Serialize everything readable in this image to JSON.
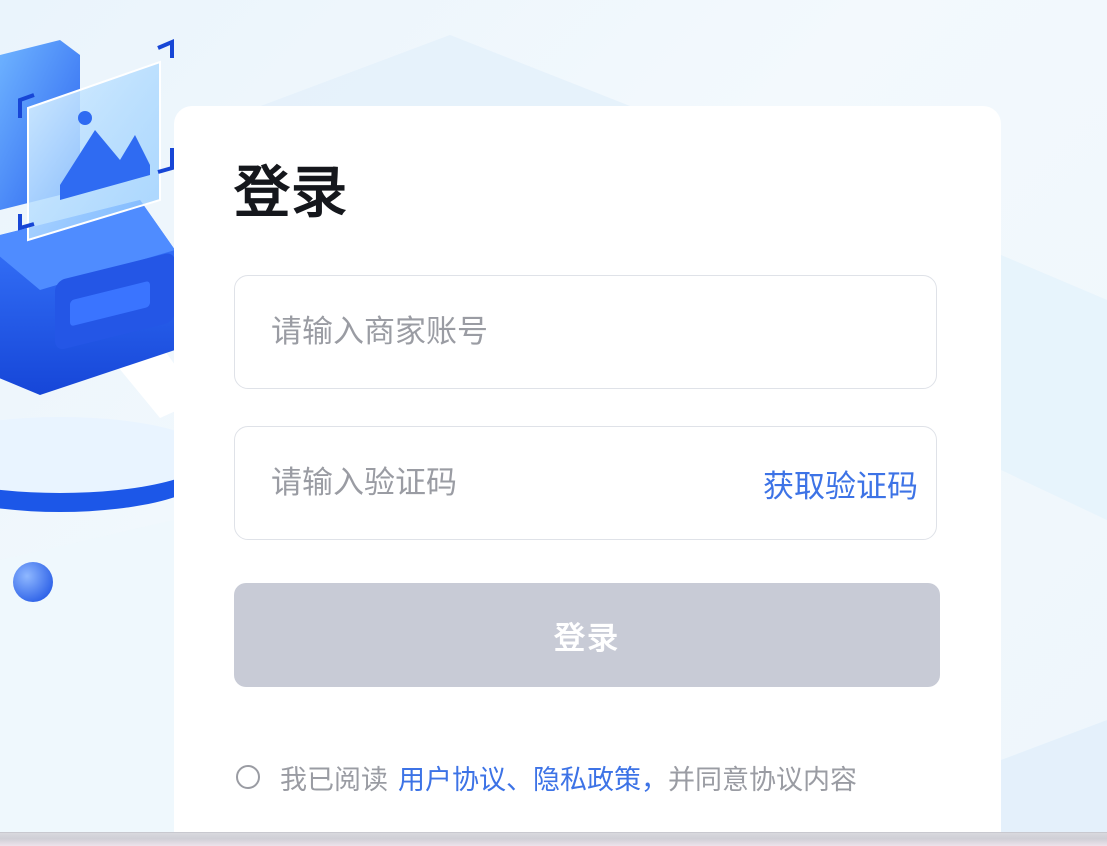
{
  "login": {
    "title": "登录",
    "account_placeholder": "请输入商家账号",
    "code_placeholder": "请输入验证码",
    "get_code_label": "获取验证码",
    "submit_label": "登录"
  },
  "agreement": {
    "prefix": "我已阅读",
    "user_agreement": "用户协议",
    "separator": "、",
    "privacy_policy": "隐私政策",
    "comma": "，",
    "suffix": "并同意协议内容",
    "checked": false
  },
  "icons": {
    "illustration": "printer-image-illustration",
    "radio": "radio-unchecked-icon"
  },
  "colors": {
    "accent": "#3d73e6",
    "button_disabled": "#c8cbd6",
    "title": "#15171c",
    "placeholder": "#9a9ca3",
    "background": "#eef6fc"
  }
}
